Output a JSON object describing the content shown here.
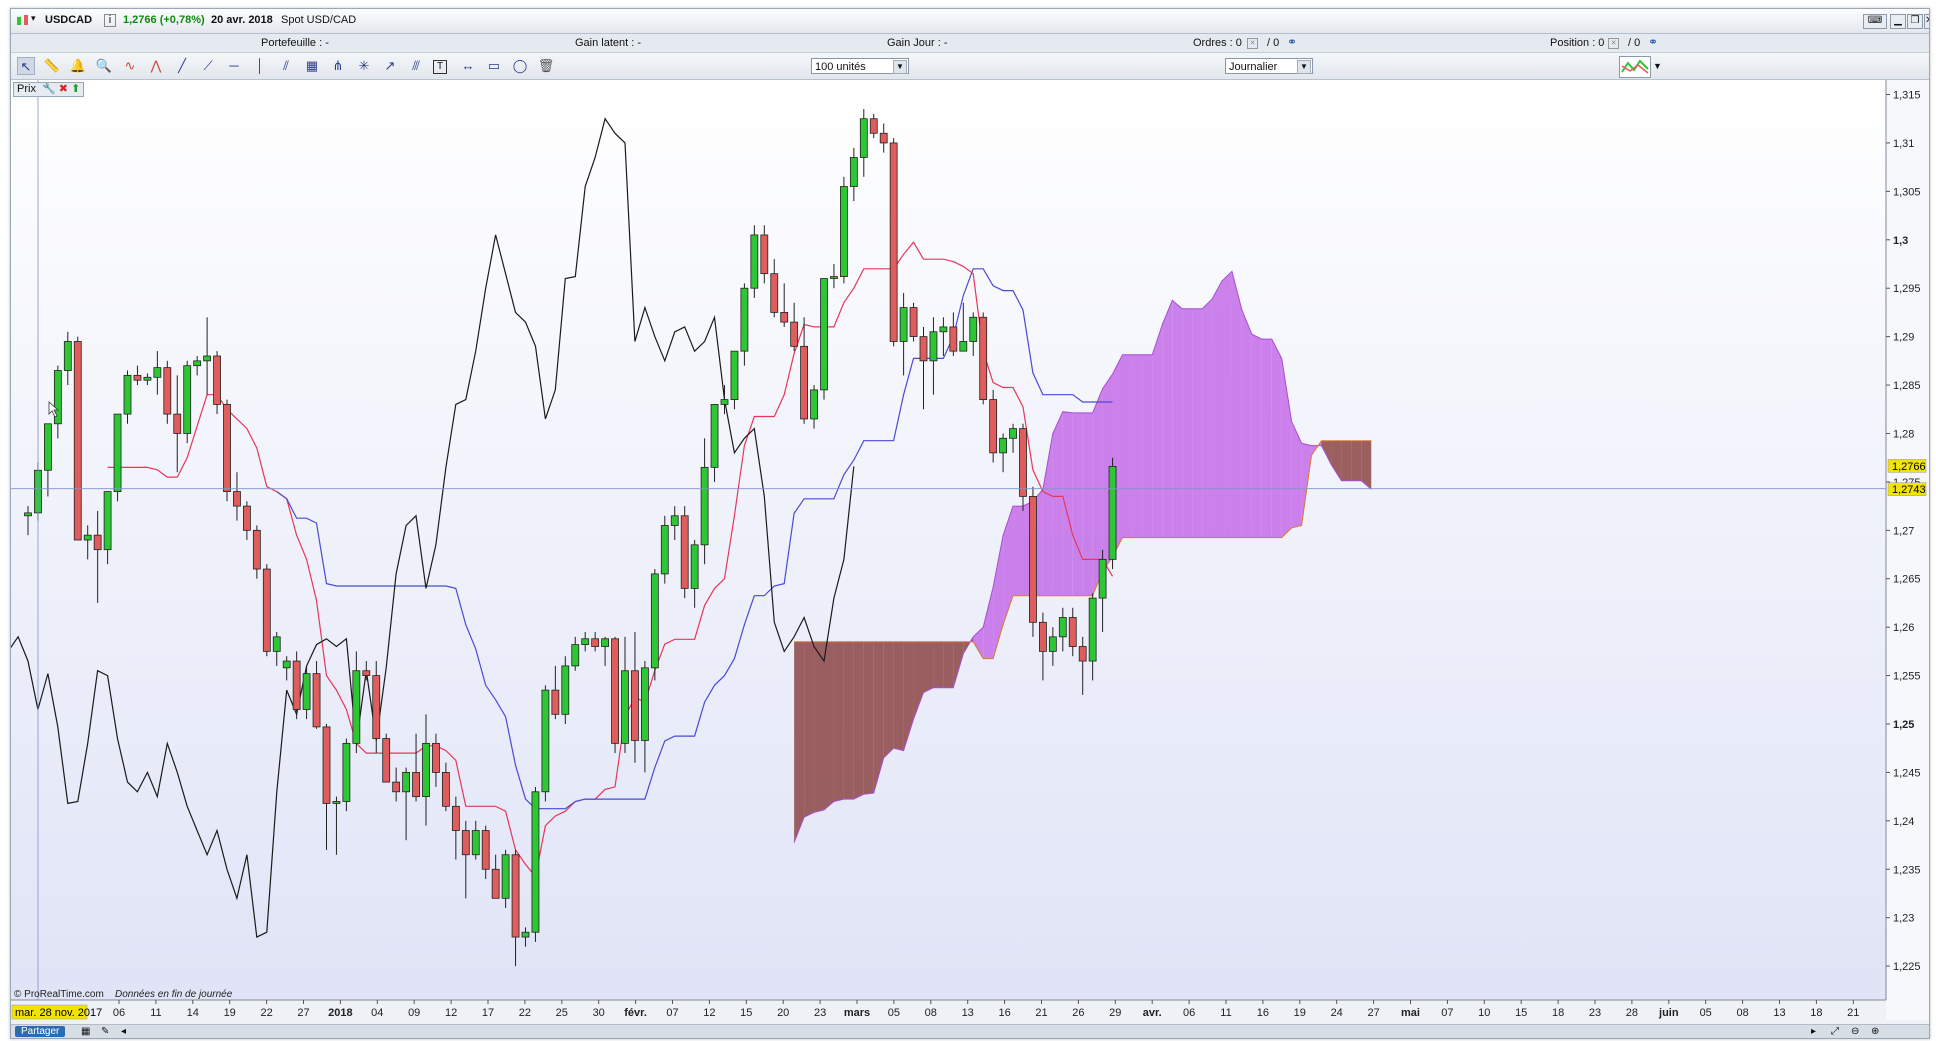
{
  "window": {
    "symbol": "USDCAD",
    "info_glyph": "i",
    "price_change": "1,2766 (+0,78%)",
    "date": "20 avr. 2018",
    "description": "Spot USD/CAD"
  },
  "info_bar": {
    "portfolio": "Portefeuille : -",
    "latent_gain": "Gain latent : -",
    "day_gain": "Gain Jour : -",
    "orders": "Ordres : 0",
    "orders_count": "/ 0",
    "position": "Position : 0",
    "position_count": "/ 0"
  },
  "toolbar": {
    "quantity": "100 unités",
    "period": "Journalier",
    "tools": [
      "cursor-icon",
      "ruler-icon",
      "alert-bell-icon",
      "zoom-icon",
      "waves-icon",
      "zigzag-icon",
      "segment-icon",
      "line-icon",
      "horizontal-line-icon",
      "vertical-line-icon",
      "channel-icon",
      "fibonacci-icon",
      "pitchfork-icon",
      "gann-icon",
      "arrow-icon",
      "parallel-icon",
      "text-icon",
      "measure-icon",
      "rectangle-icon",
      "ellipse-icon",
      "trash-icon"
    ]
  },
  "chart_tab": {
    "label": "Prix"
  },
  "footer": {
    "share": "Partager",
    "copyright": "© ProRealTime.com",
    "data_note": "Données en fin de journée"
  },
  "colors": {
    "bull": "#2fc635",
    "bear": "#e05d5d",
    "tenkan": "#e8365a",
    "kijun": "#4a4ad6",
    "chikou": "#1a1a1a",
    "cloud_bull": "#c56fe8",
    "cloud_bear": "#8e4a4a",
    "price_marker": "#f0e400"
  },
  "chart_data": {
    "type": "candlestick",
    "symbol": "USDCAD",
    "period": "Journalier",
    "ylim": [
      1.2215,
      1.3165
    ],
    "y_ticks": [
      "1,315",
      "1,31",
      "1,305",
      "1,3",
      "1,295",
      "1,29",
      "1,285",
      "1,28",
      "1,275",
      "1,27",
      "1,265",
      "1,26",
      "1,255",
      "1,25",
      "1,245",
      "1,24",
      "1,235",
      "1,23",
      "1,225"
    ],
    "y_ticks_bold": [
      "1,3",
      "1,25"
    ],
    "last_price_label": "1,2766",
    "crosshair_price_label": "1,2743",
    "crosshair_price": 1.2743,
    "crosshair_date_label": "mar. 28 nov. 2017",
    "x_ticks": [
      "06",
      "11",
      "14",
      "19",
      "22",
      "27",
      "2018",
      "04",
      "09",
      "12",
      "17",
      "22",
      "25",
      "30",
      "févr.",
      "07",
      "12",
      "15",
      "20",
      "23",
      "mars",
      "05",
      "08",
      "13",
      "16",
      "21",
      "26",
      "29",
      "avr.",
      "06",
      "11",
      "16",
      "19",
      "24",
      "27",
      "mai",
      "07",
      "10",
      "15",
      "18",
      "23",
      "28",
      "juin",
      "05",
      "08",
      "13",
      "18",
      "21"
    ],
    "x_ticks_bold": [
      "2018",
      "févr.",
      "mars",
      "avr.",
      "mai",
      "juin"
    ],
    "candles": [
      [
        1.2715,
        1.2725,
        1.2695,
        1.2718
      ],
      [
        1.2718,
        1.277,
        1.271,
        1.2762
      ],
      [
        1.2762,
        1.281,
        1.2735,
        1.281
      ],
      [
        1.281,
        1.287,
        1.2795,
        1.2865
      ],
      [
        1.2865,
        1.2905,
        1.285,
        1.2895
      ],
      [
        1.2895,
        1.29,
        1.269,
        1.269
      ],
      [
        1.269,
        1.2705,
        1.267,
        1.2695
      ],
      [
        1.2695,
        1.272,
        1.2625,
        1.268
      ],
      [
        1.268,
        1.274,
        1.2665,
        1.274
      ],
      [
        1.274,
        1.282,
        1.273,
        1.282
      ],
      [
        1.282,
        1.2865,
        1.281,
        1.286
      ],
      [
        1.286,
        1.287,
        1.285,
        1.2855
      ],
      [
        1.2855,
        1.2862,
        1.285,
        1.2858
      ],
      [
        1.2858,
        1.2885,
        1.284,
        1.2868
      ],
      [
        1.2868,
        1.2875,
        1.281,
        1.282
      ],
      [
        1.282,
        1.286,
        1.276,
        1.28
      ],
      [
        1.28,
        1.2875,
        1.279,
        1.287
      ],
      [
        1.287,
        1.288,
        1.286,
        1.2875
      ],
      [
        1.2875,
        1.292,
        1.284,
        1.288
      ],
      [
        1.288,
        1.2885,
        1.282,
        1.283
      ],
      [
        1.283,
        1.2835,
        1.273,
        1.274
      ],
      [
        1.274,
        1.276,
        1.271,
        1.2725
      ],
      [
        1.2725,
        1.273,
        1.269,
        1.27
      ],
      [
        1.27,
        1.2705,
        1.265,
        1.266
      ],
      [
        1.266,
        1.2665,
        1.257,
        1.2575
      ],
      [
        1.2575,
        1.2595,
        1.256,
        1.259
      ],
      [
        1.2558,
        1.257,
        1.2545,
        1.2565
      ],
      [
        1.2565,
        1.2575,
        1.2505,
        1.2515
      ],
      [
        1.2515,
        1.256,
        1.2505,
        1.2552
      ],
      [
        1.2552,
        1.2565,
        1.2495,
        1.2497
      ],
      [
        1.2497,
        1.25,
        1.237,
        1.2418
      ],
      [
        1.2418,
        1.2425,
        1.2365,
        1.242
      ],
      [
        1.242,
        1.2485,
        1.241,
        1.248
      ],
      [
        1.248,
        1.2575,
        1.247,
        1.2555
      ],
      [
        1.2555,
        1.2565,
        1.2545,
        1.255
      ],
      [
        1.255,
        1.2565,
        1.247,
        1.2485
      ],
      [
        1.2485,
        1.249,
        1.244,
        1.244
      ],
      [
        1.244,
        1.2455,
        1.242,
        1.243
      ],
      [
        1.243,
        1.2455,
        1.238,
        1.245
      ],
      [
        1.245,
        1.249,
        1.242,
        1.2425
      ],
      [
        1.2425,
        1.251,
        1.2395,
        1.248
      ],
      [
        1.248,
        1.249,
        1.2435,
        1.245
      ],
      [
        1.245,
        1.246,
        1.241,
        1.2415
      ],
      [
        1.2415,
        1.2425,
        1.236,
        1.239
      ],
      [
        1.239,
        1.24,
        1.232,
        1.2365
      ],
      [
        1.2365,
        1.24,
        1.236,
        1.239
      ],
      [
        1.239,
        1.2395,
        1.234,
        1.235
      ],
      [
        1.235,
        1.2365,
        1.232,
        1.232
      ],
      [
        1.232,
        1.237,
        1.231,
        1.2365
      ],
      [
        1.2365,
        1.237,
        1.225,
        1.228
      ],
      [
        1.228,
        1.229,
        1.227,
        1.2285
      ],
      [
        1.2285,
        1.2435,
        1.2275,
        1.243
      ],
      [
        1.243,
        1.254,
        1.242,
        1.2535
      ],
      [
        1.2535,
        1.256,
        1.2505,
        1.251
      ],
      [
        1.251,
        1.257,
        1.25,
        1.256
      ],
      [
        1.256,
        1.259,
        1.2555,
        1.2582
      ],
      [
        1.2582,
        1.2595,
        1.2575,
        1.2588
      ],
      [
        1.2588,
        1.2595,
        1.2575,
        1.258
      ],
      [
        1.258,
        1.259,
        1.256,
        1.2588
      ],
      [
        1.2588,
        1.259,
        1.247,
        1.248
      ],
      [
        1.248,
        1.259,
        1.247,
        1.2555
      ],
      [
        1.2555,
        1.2595,
        1.246,
        1.2483
      ],
      [
        1.2483,
        1.2565,
        1.245,
        1.2558
      ],
      [
        1.2558,
        1.266,
        1.2545,
        1.2655
      ],
      [
        1.2655,
        1.2715,
        1.2645,
        1.2705
      ],
      [
        1.2705,
        1.2725,
        1.269,
        1.2715
      ],
      [
        1.2715,
        1.2725,
        1.263,
        1.264
      ],
      [
        1.264,
        1.269,
        1.262,
        1.2685
      ],
      [
        1.2685,
        1.2795,
        1.2665,
        1.2765
      ],
      [
        1.2765,
        1.283,
        1.275,
        1.283
      ],
      [
        1.283,
        1.285,
        1.282,
        1.2835
      ],
      [
        1.2835,
        1.2885,
        1.2825,
        1.2885
      ],
      [
        1.2885,
        1.2955,
        1.287,
        1.295
      ],
      [
        1.295,
        1.3015,
        1.294,
        1.3005
      ],
      [
        1.3005,
        1.3015,
        1.2955,
        1.2965
      ],
      [
        1.2965,
        1.298,
        1.292,
        1.2925
      ],
      [
        1.2925,
        1.2955,
        1.291,
        1.2915
      ],
      [
        1.2915,
        1.2935,
        1.2885,
        1.289
      ],
      [
        1.289,
        1.292,
        1.281,
        1.2815
      ],
      [
        1.2815,
        1.285,
        1.2805,
        1.2845
      ],
      [
        1.2845,
        1.296,
        1.2835,
        1.296
      ],
      [
        1.296,
        1.2975,
        1.295,
        1.2962
      ],
      [
        1.2962,
        1.3065,
        1.2955,
        1.3055
      ],
      [
        1.3055,
        1.3095,
        1.304,
        1.3085
      ],
      [
        1.3085,
        1.3135,
        1.3065,
        1.3125
      ],
      [
        1.3125,
        1.313,
        1.3105,
        1.311
      ],
      [
        1.311,
        1.312,
        1.309,
        1.31
      ],
      [
        1.31,
        1.3105,
        1.289,
        1.2895
      ],
      [
        1.2895,
        1.2945,
        1.286,
        1.293
      ],
      [
        1.293,
        1.2935,
        1.2895,
        1.29
      ],
      [
        1.29,
        1.291,
        1.2825,
        1.2875
      ],
      [
        1.2875,
        1.292,
        1.284,
        1.2905
      ],
      [
        1.2905,
        1.292,
        1.288,
        1.291
      ],
      [
        1.291,
        1.2925,
        1.288,
        1.2885
      ],
      [
        1.2885,
        1.2935,
        1.2885,
        1.2895
      ],
      [
        1.2895,
        1.2925,
        1.288,
        1.292
      ],
      [
        1.292,
        1.2925,
        1.283,
        1.2835
      ],
      [
        1.2835,
        1.2845,
        1.277,
        1.278
      ],
      [
        1.278,
        1.28,
        1.276,
        1.2795
      ],
      [
        1.2795,
        1.281,
        1.278,
        1.2805
      ],
      [
        1.2805,
        1.281,
        1.272,
        1.2735
      ],
      [
        1.2735,
        1.2745,
        1.259,
        1.2605
      ],
      [
        1.2605,
        1.2615,
        1.2545,
        1.2575
      ],
      [
        1.2575,
        1.26,
        1.256,
        1.259
      ],
      [
        1.259,
        1.262,
        1.2575,
        1.261
      ],
      [
        1.261,
        1.262,
        1.257,
        1.258
      ],
      [
        1.258,
        1.259,
        1.253,
        1.2565
      ],
      [
        1.2565,
        1.2635,
        1.2545,
        1.263
      ],
      [
        1.263,
        1.268,
        1.2595,
        1.267
      ],
      [
        1.267,
        1.2775,
        1.266,
        1.2766
      ]
    ]
  }
}
